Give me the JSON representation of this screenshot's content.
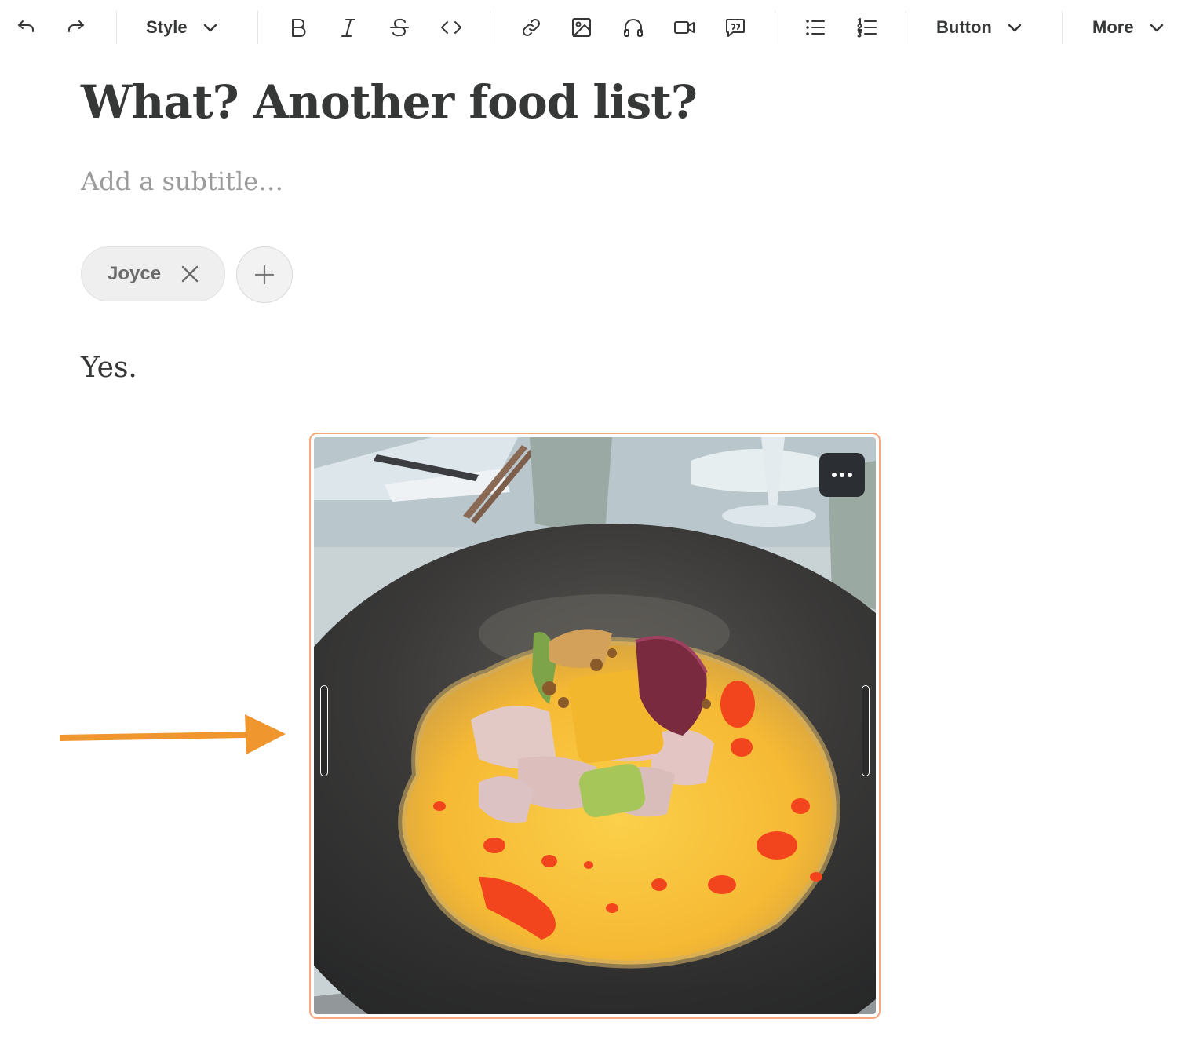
{
  "toolbar": {
    "style_label": "Style",
    "button_label": "Button",
    "more_label": "More",
    "icons": [
      "undo-icon",
      "redo-icon",
      "bold-icon",
      "italic-icon",
      "strikethrough-icon",
      "code-icon",
      "link-icon",
      "image-icon",
      "audio-icon",
      "video-icon",
      "quote-icon",
      "bullet-list-icon",
      "numbered-list-icon",
      "chevron-down-icon"
    ]
  },
  "post": {
    "title": "What? Another food list?",
    "subtitle_placeholder": "Add a subtitle…",
    "subtitle_value": "",
    "authors": [
      "Joyce"
    ],
    "body_text": "Yes."
  },
  "image_block": {
    "selected": true,
    "accent_color": "#f6a77b",
    "menu_icon": "more-horizontal-icon"
  },
  "annotation": {
    "arrow_color": "#f0962f"
  }
}
